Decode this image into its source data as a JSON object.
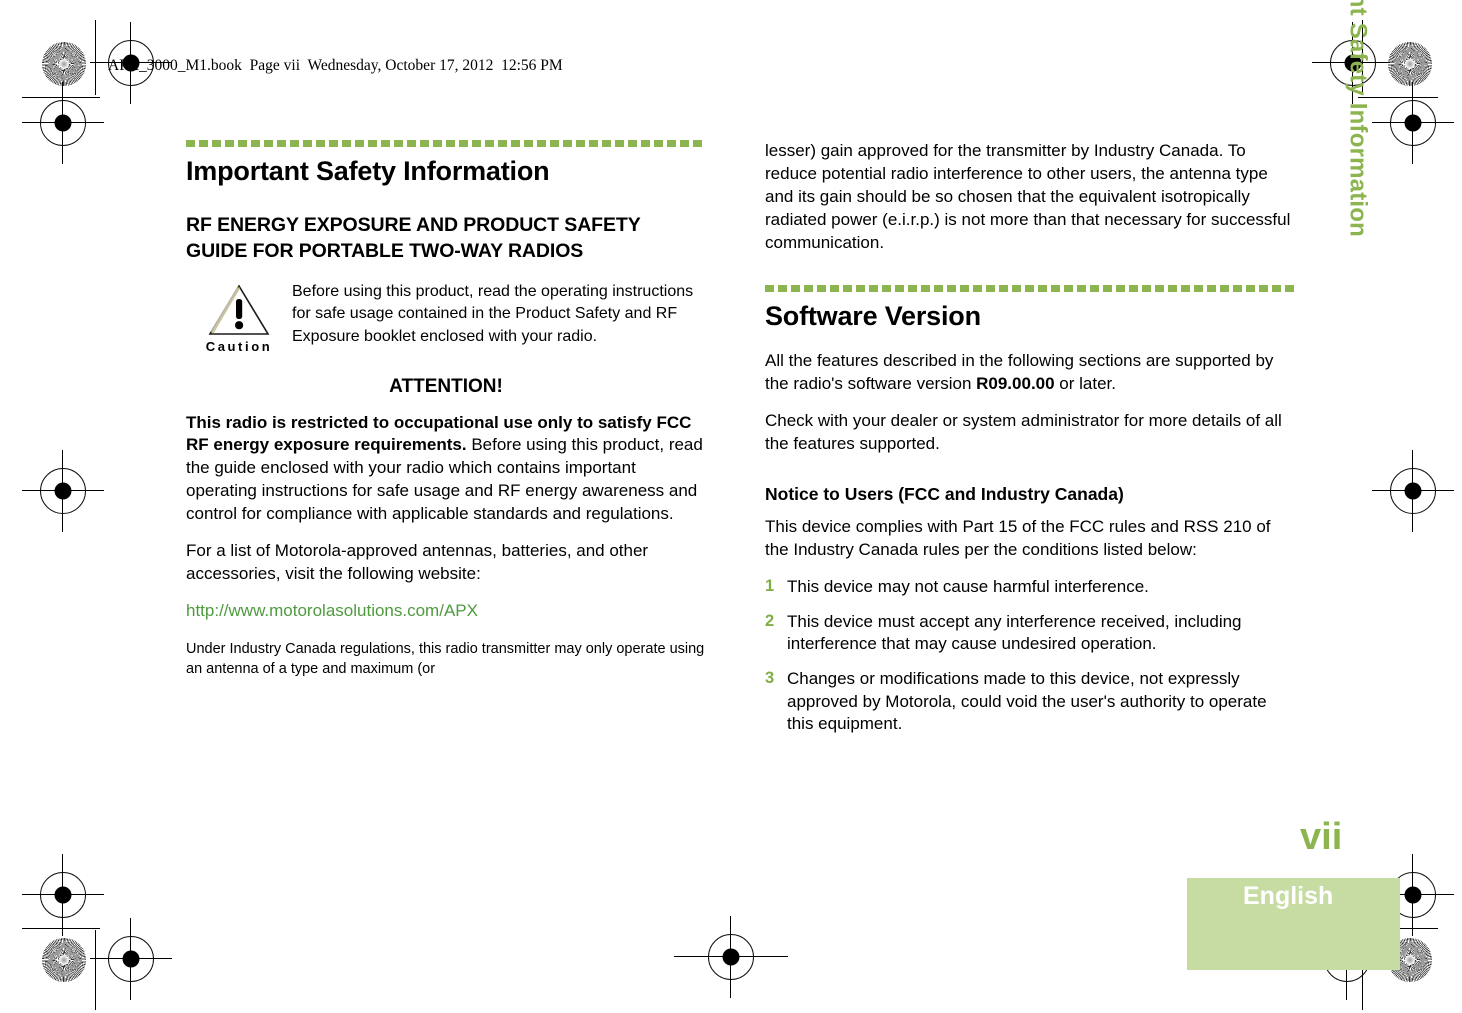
{
  "book_header": "APX_3000_M1.book  Page vii  Wednesday, October 17, 2012  12:56 PM",
  "colors": {
    "accent_green": "#8cb44f",
    "link_green": "#4f9a3f",
    "band_green": "#c6dca2",
    "list_number_green": "#7fae44"
  },
  "left_column": {
    "section_title": "Important Safety Information",
    "guide_heading": "RF ENERGY EXPOSURE AND PRODUCT SAFETY GUIDE FOR PORTABLE TWO-WAY RADIOS",
    "caution": {
      "icon_label": "Caution",
      "text": "Before using this product, read the operating instructions for safe usage contained in the Product Safety and RF Exposure booklet enclosed with your radio."
    },
    "attention_heading": "ATTENTION!",
    "attention_bold_lead": "This radio is restricted to occupational use only to satisfy FCC RF energy exposure requirements.",
    "attention_body": " Before using this product, read the guide enclosed with your radio which contains important operating instructions for safe usage and RF energy awareness and control for compliance with applicable standards and regulations.",
    "antenna_paragraph": "For a list of Motorola-approved antennas, batteries, and other accessories, visit the following website:",
    "website_url": "http://www.motorolasolutions.com/APX",
    "industry_canada_partial": "Under Industry Canada regulations, this radio transmitter may only operate using an antenna of a type and maximum (or"
  },
  "right_column": {
    "continuation_paragraph": "lesser) gain approved for the transmitter by Industry Canada. To reduce potential radio interference to other users, the antenna type and its gain should be so chosen that the equivalent isotropically radiated power (e.i.r.p.) is not more than that necessary for successful communication.",
    "software_version": {
      "title": "Software Version",
      "paragraph_part1": "All the features described in the following sections are supported by the radio's software version ",
      "version": "R09.00.00",
      "paragraph_part2": " or later.",
      "check_paragraph": "Check with your dealer or system administrator for more details of all the features supported."
    },
    "notice": {
      "title": "Notice to Users (FCC and Industry Canada)",
      "intro": "This device complies with Part 15 of the FCC rules and RSS 210 of the Industry Canada rules per the conditions listed below:",
      "items": [
        {
          "num": "1",
          "text": "This device may not cause harmful interference."
        },
        {
          "num": "2",
          "text": "This device must accept any interference received, including interference that may cause undesired operation."
        },
        {
          "num": "3",
          "text": "Changes or modifications made to this device, not expressly approved by Motorola, could void the user's authority to operate this equipment."
        }
      ]
    }
  },
  "sidebar": {
    "vertical_title": "Important Safety Information",
    "page_number": "vii",
    "language": "English"
  }
}
